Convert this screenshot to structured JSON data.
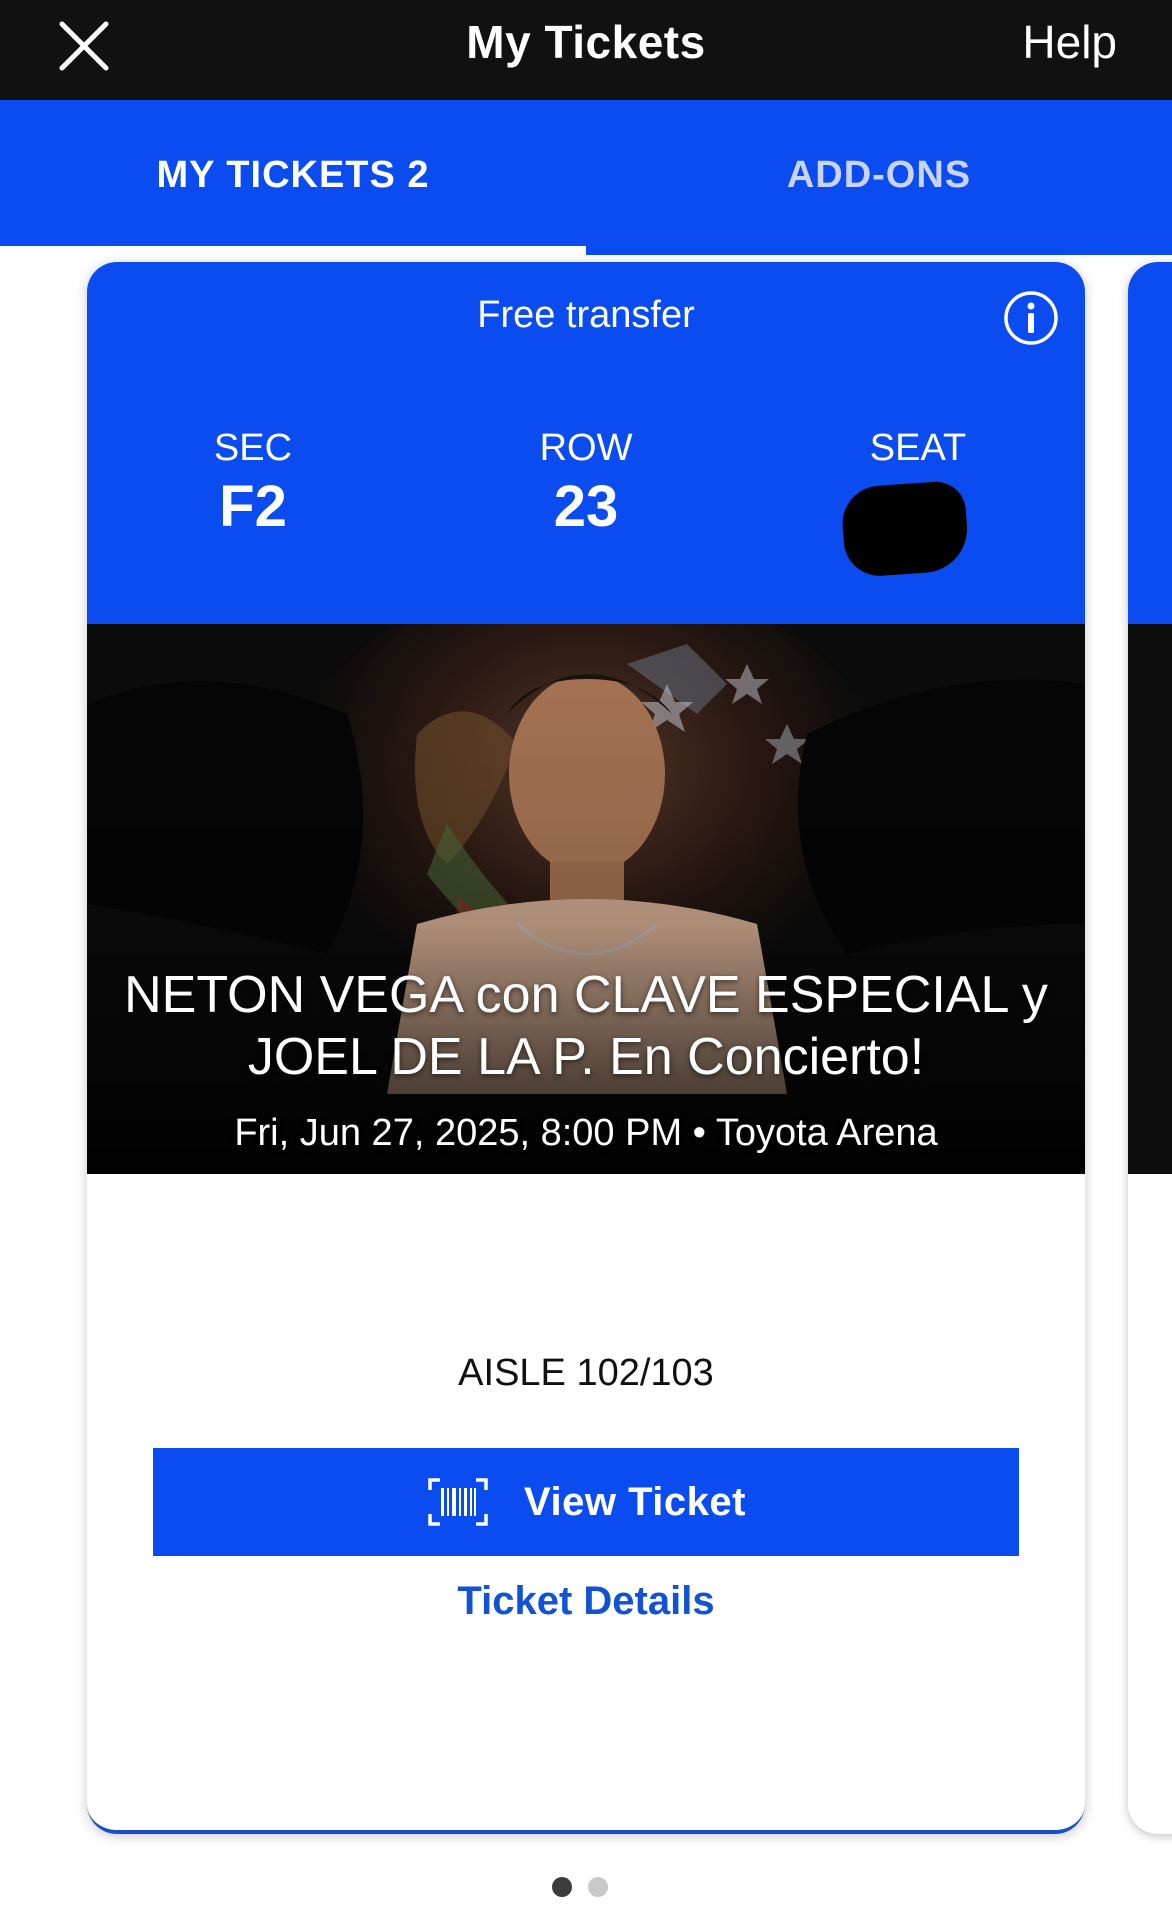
{
  "topbar": {
    "title": "My Tickets",
    "help_label": "Help",
    "close_icon": "close-icon"
  },
  "tabs": [
    {
      "label": "MY TICKETS 2",
      "active": true
    },
    {
      "label": "ADD-ONS",
      "active": false
    }
  ],
  "ticket": {
    "transfer_label": "Free transfer",
    "info_icon": "info-icon",
    "section_label": "SEC",
    "section_value": "F2",
    "row_label": "ROW",
    "row_value": "23",
    "seat_label": "SEAT",
    "event_title": "NETON VEGA con CLAVE ESPECIAL y JOEL DE LA P. En Concierto!",
    "event_meta": "Fri, Jun 27, 2025, 8:00 PM • Toyota Arena",
    "aisle": "AISLE 102/103",
    "view_button_label": "View Ticket",
    "view_button_icon": "barcode-icon",
    "details_label": "Ticket Details"
  },
  "pagination": {
    "total": 2,
    "current": 1
  },
  "colors": {
    "brand_blue": "#0a4cf0",
    "topbar": "#111111",
    "link_blue": "#1252d4"
  }
}
